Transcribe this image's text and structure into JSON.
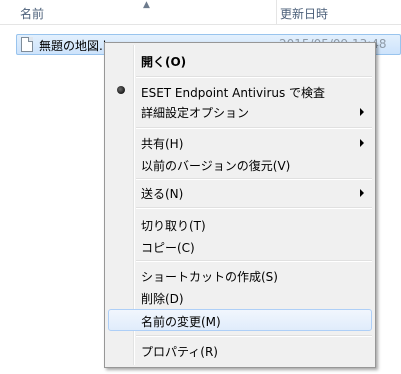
{
  "explorer": {
    "columns": {
      "name": "名前",
      "date_modified": "更新日時"
    },
    "file": {
      "name": "無題の地図.kmz",
      "date": "2015/05/09 13:48"
    }
  },
  "context_menu": {
    "open": "開く(O)",
    "eset_scan": "ESET Endpoint Antivirus で検査",
    "advanced_options": "詳細設定オプション",
    "share": "共有(H)",
    "restore_previous": "以前のバージョンの復元(V)",
    "send_to": "送る(N)",
    "cut": "切り取り(T)",
    "copy": "コピー(C)",
    "create_shortcut": "ショートカットの作成(S)",
    "delete": "削除(D)",
    "rename": "名前の変更(M)",
    "properties": "プロパティ(R)"
  }
}
